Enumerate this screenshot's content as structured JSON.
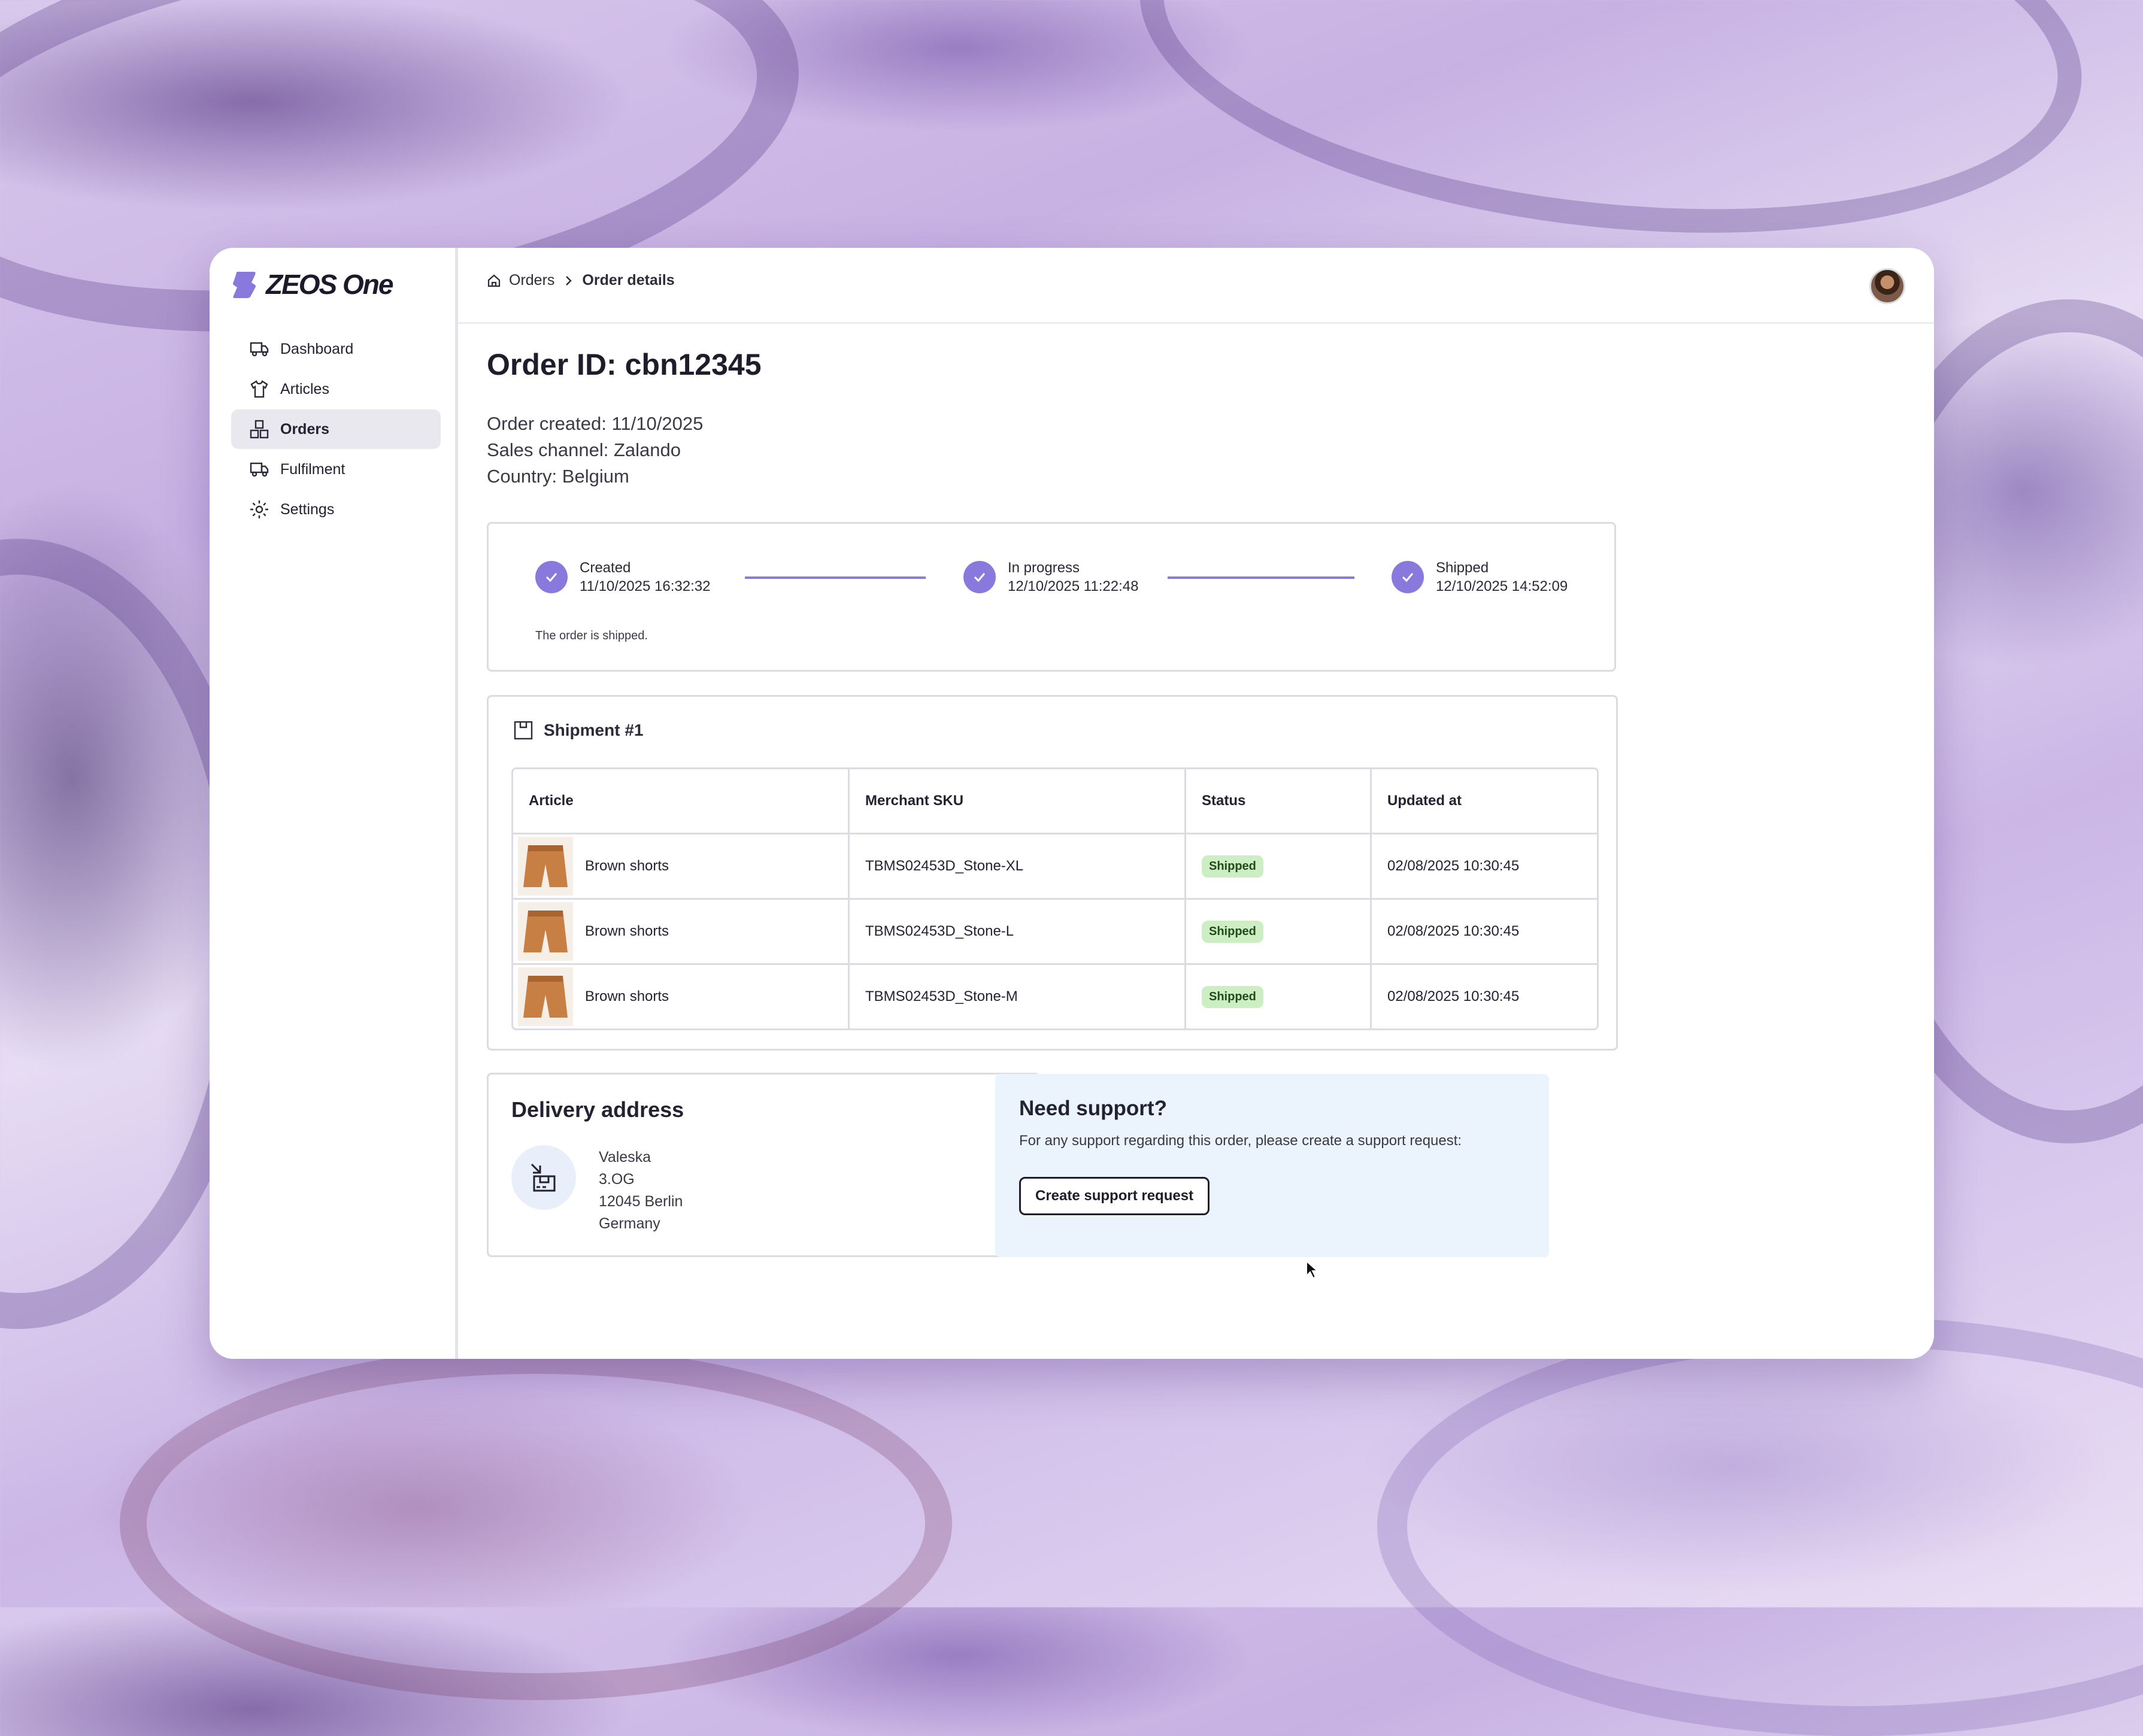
{
  "app": {
    "logo_text": "ZEOS One",
    "logo_color": "#8a79dc"
  },
  "sidebar": {
    "items": [
      {
        "label": "Dashboard",
        "icon": "truck-icon"
      },
      {
        "label": "Articles",
        "icon": "shirt-icon"
      },
      {
        "label": "Orders",
        "icon": "boxes-icon",
        "active": true
      },
      {
        "label": "Fulfilment",
        "icon": "truck-icon"
      },
      {
        "label": "Settings",
        "icon": "gear-icon"
      }
    ]
  },
  "breadcrumb": {
    "home_icon": "home-icon",
    "parent": "Orders",
    "current": "Order details"
  },
  "order": {
    "title": "Order ID: cbn12345",
    "created": "Order created: 11/10/2025",
    "channel": "Sales channel: Zalando",
    "country": "Country: Belgium"
  },
  "tracker": {
    "accent": "#8a79dc",
    "steps": [
      {
        "label": "Created",
        "time": "11/10/2025 16:32:32"
      },
      {
        "label": "In progress",
        "time": "12/10/2025 11:22:48"
      },
      {
        "label": "Shipped",
        "time": "12/10/2025 14:52:09"
      }
    ],
    "note": "The order is shipped."
  },
  "shipment": {
    "title": "Shipment #1",
    "columns": [
      "Article",
      "Merchant SKU",
      "Status",
      "Updated at"
    ],
    "rows": [
      {
        "article": "Brown shorts",
        "sku": "TBMS02453D_Stone-XL",
        "status": "Shipped",
        "updated": "02/08/2025 10:30:45"
      },
      {
        "article": "Brown shorts",
        "sku": "TBMS02453D_Stone-L",
        "status": "Shipped",
        "updated": "02/08/2025 10:30:45"
      },
      {
        "article": "Brown shorts",
        "sku": "TBMS02453D_Stone-M",
        "status": "Shipped",
        "updated": "02/08/2025 10:30:45"
      }
    ],
    "status_color": "#cdeec3"
  },
  "delivery": {
    "title": "Delivery address",
    "lines": [
      "Valeska",
      "3.OG",
      "12045 Berlin",
      "Germany"
    ]
  },
  "support": {
    "title": "Need support?",
    "text": "For any support regarding this order, please create a support request:",
    "button": "Create support request",
    "background": "#ebf3fd"
  }
}
